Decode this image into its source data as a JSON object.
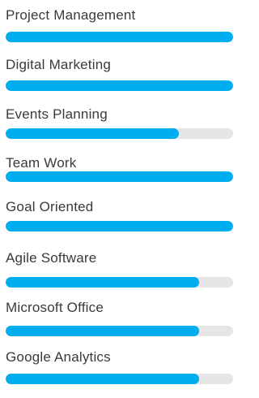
{
  "skills": [
    {
      "label": "Project Management",
      "percent": 100
    },
    {
      "label": "Digital Marketing",
      "percent": 100
    },
    {
      "label": "Events Planning",
      "percent": 76
    },
    {
      "label": "Team Work",
      "percent": 100
    },
    {
      "label": "Goal Oriented",
      "percent": 100
    },
    {
      "label": "Agile Software",
      "percent": 85
    },
    {
      "label": "Microsoft Office",
      "percent": 85
    },
    {
      "label": "Google Analytics",
      "percent": 85
    }
  ],
  "colors": {
    "fill": "#00aeef",
    "track": "#e6e6e6",
    "label": "#3a3a3a"
  }
}
